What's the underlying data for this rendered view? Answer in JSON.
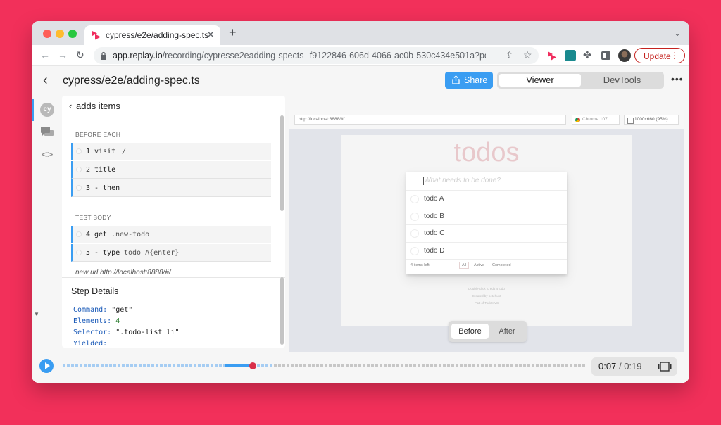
{
  "browser": {
    "tab_title": "cypress/e2e/adding-spec.ts",
    "url_host": "app.replay.io",
    "url_path": "/recording/cypresse2eadding-spects--f9122846-606d-4066-ac0b-530c434e501a?poi...",
    "update_label": "Update"
  },
  "app": {
    "title": "cypress/e2e/adding-spec.ts",
    "share_label": "Share",
    "viewer_label": "Viewer",
    "devtools_label": "DevTools"
  },
  "panel": {
    "title": "adds items",
    "before_each_label": "BEFORE EACH",
    "test_body_label": "TEST BODY",
    "steps": [
      {
        "num": "1",
        "cmd": "visit",
        "arg": "/"
      },
      {
        "num": "2",
        "cmd": "title",
        "arg": ""
      },
      {
        "num": "3",
        "cmd": "- then",
        "arg": ""
      },
      {
        "num": "4",
        "cmd": "get",
        "arg": ".new-todo"
      },
      {
        "num": "5",
        "cmd": "- type",
        "arg": "todo A{enter}"
      }
    ],
    "new_url": "new url http://localhost:8888/#/"
  },
  "details": {
    "title": "Step Details",
    "command_key": "Command:",
    "command_val": "\"get\"",
    "elements_key": "Elements:",
    "elements_val": "4",
    "selector_key": "Selector:",
    "selector_val": "\".todo-list li\"",
    "yielded_key": "Yielded:"
  },
  "viewer": {
    "url": "http://localhost:8888/#/",
    "browser": "Chrome 107",
    "size": "1000x660  (95%)",
    "app_title": "todos",
    "placeholder": "What needs to be done?",
    "todos": [
      "todo A",
      "todo B",
      "todo C",
      "todo D"
    ],
    "items_left": "4 items left",
    "filter_all": "All",
    "filter_active": "Active",
    "filter_completed": "Completed",
    "info_1": "Double-click to edit a todo",
    "info_2": "Created by petehunt",
    "info_3": "Part of TodoMVC",
    "before_label": "Before",
    "after_label": "After"
  },
  "timeline": {
    "current": "0:07",
    "separator": "/",
    "total": "0:19",
    "progress": 0.363,
    "marked_until": 0.4
  },
  "colors": {
    "background": "#f2305a",
    "accent": "#3a9df2",
    "playhead": "#d9304a"
  }
}
